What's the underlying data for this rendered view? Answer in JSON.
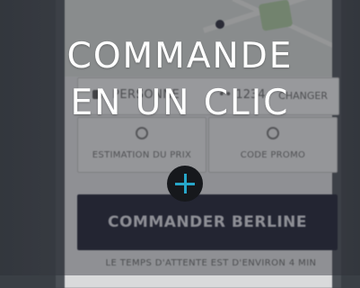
{
  "headline": {
    "line1": "COMMANDE",
    "line2": "EN UN CLIC"
  },
  "booking": {
    "passenger_label": "PERSONNE",
    "phone_partial": "•• 1234",
    "change_label": "CHANGER",
    "tiles": [
      {
        "label": "ESTIMATION DU PRIX",
        "icon": "estimate-icon"
      },
      {
        "label": "CODE PROMO",
        "icon": "promo-icon"
      }
    ],
    "cta_label": "COMMANDER BERLINE",
    "footer_note": "LE TEMPS D'ATTENTE EST D'ENVIRON 4 MIN"
  },
  "colors": {
    "cta_bg": "#1f2133",
    "accent": "#27a6c9",
    "overlay": "#282c32"
  }
}
